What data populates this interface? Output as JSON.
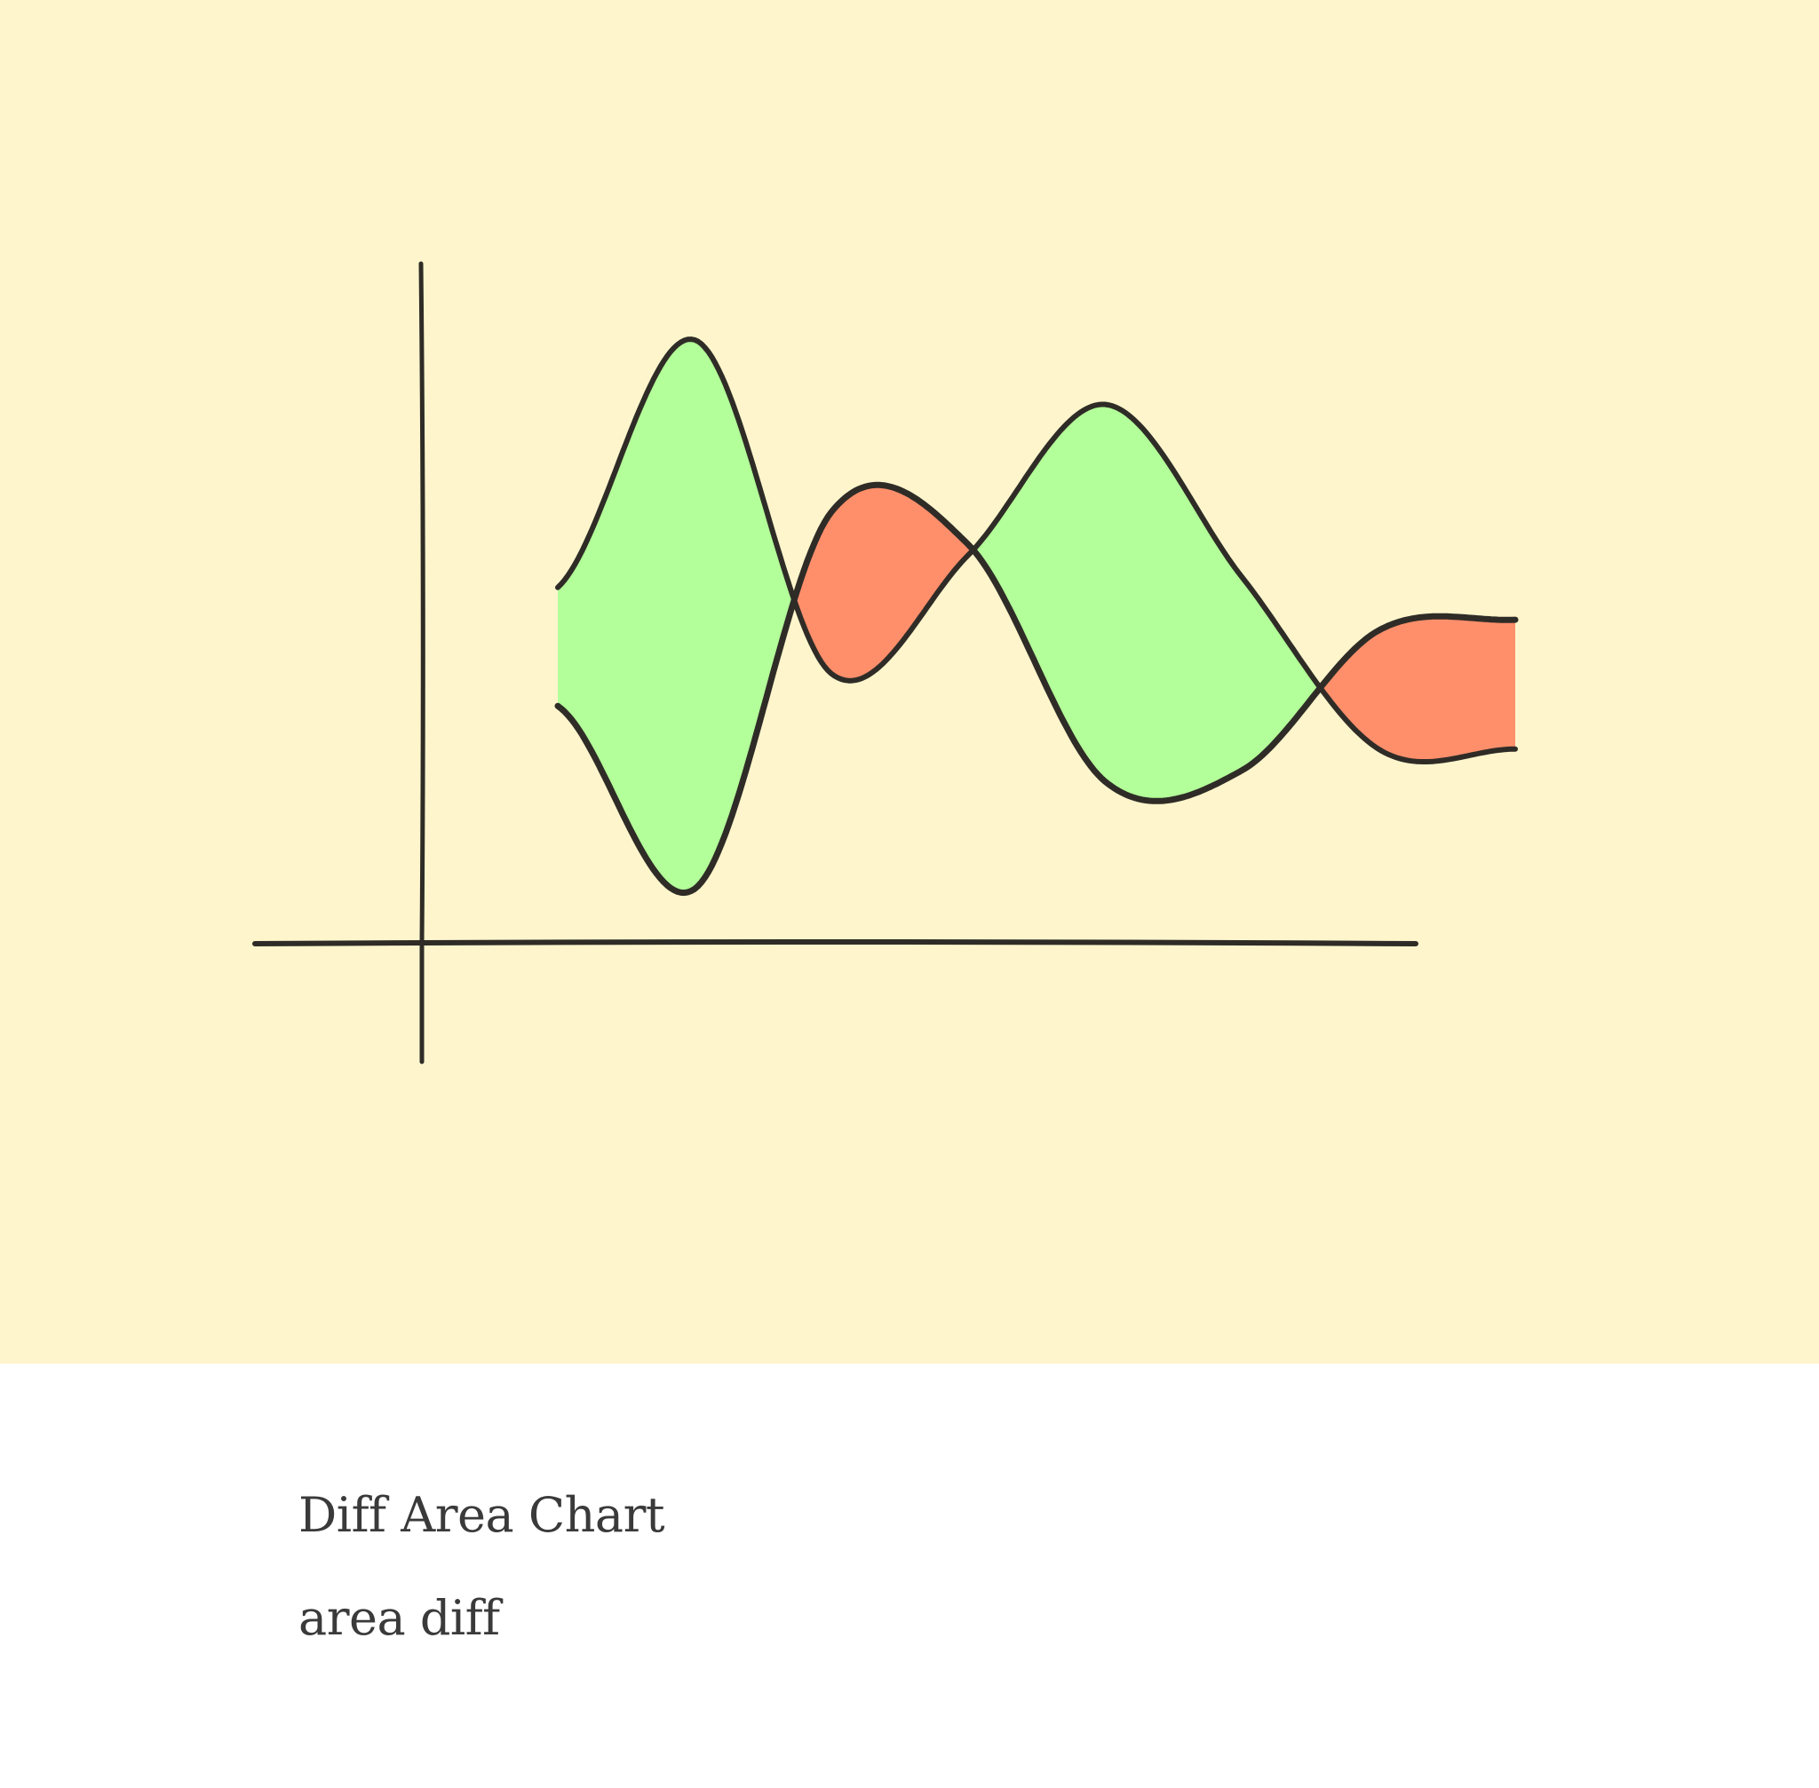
{
  "card": {
    "title": "Diff Area Chart",
    "subtitle": "area diff"
  },
  "colors": {
    "background": "#fef5cc",
    "positive_fill": "#b3ff99",
    "negative_fill": "#ff8f6b",
    "stroke": "#2f2c27"
  },
  "chart_data": {
    "type": "area",
    "variant": "difference",
    "title": "",
    "xlabel": "",
    "ylabel": "",
    "axis_ticks": false,
    "grid": false,
    "legend": "none",
    "x": [
      0,
      1,
      2,
      3,
      4,
      5,
      6,
      7
    ],
    "xlim": [
      -1,
      6
    ],
    "ylim": [
      0,
      6.2
    ],
    "series": [
      {
        "values": [
          3.3,
          5.6,
          2.5,
          3.6,
          5.0,
          3.4,
          1.8,
          1.8
        ]
      },
      {
        "values": [
          2.2,
          0.5,
          4.0,
          3.7,
          1.5,
          1.6,
          2.9,
          3.0
        ]
      }
    ],
    "fill_rule": {
      "first_above_second": "positive_fill",
      "second_above_first": "negative_fill"
    }
  }
}
